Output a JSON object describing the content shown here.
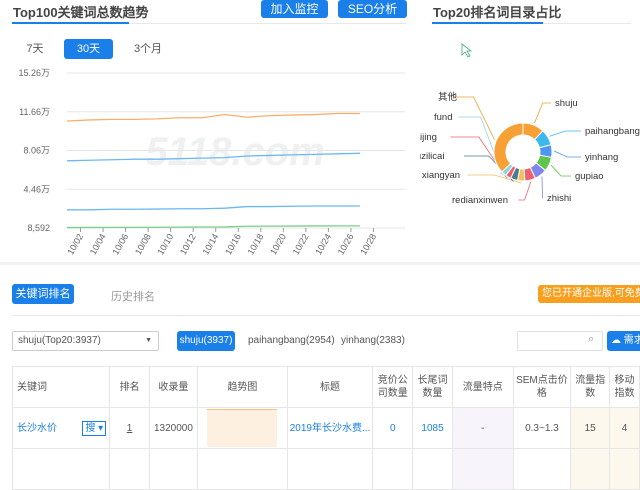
{
  "trend": {
    "title": "Top100关键词总数趋势",
    "btn_monitor": "加入监控",
    "btn_seo": "SEO分析",
    "ranges": [
      "7天",
      "30天",
      "3个月"
    ],
    "active_range": "30天"
  },
  "chart_data": {
    "type": "line",
    "title": "Top100关键词总数趋势",
    "y_ticks": [
      "8,592",
      "4.46万",
      "8.06万",
      "11.66万",
      "15.26万"
    ],
    "ylim": [
      8592,
      152592
    ],
    "x": [
      "10/02",
      "10/04",
      "10/06",
      "10/08",
      "10/10",
      "10/12",
      "10/14",
      "10/16",
      "10/18",
      "10/20",
      "10/22",
      "10/24",
      "10/26",
      "10/28"
    ],
    "series": [
      {
        "name": "series-orange",
        "color": "#f7b06a",
        "values": [
          108000,
          109000,
          109500,
          109500,
          110000,
          111000,
          111000,
          114000,
          111500,
          113000,
          113500,
          114000,
          115000,
          115000
        ]
      },
      {
        "name": "series-blue-1",
        "color": "#6cb8f0",
        "values": [
          71000,
          71500,
          72000,
          72500,
          72500,
          73000,
          73500,
          74000,
          75500,
          76000,
          76500,
          77000,
          77500,
          78000
        ]
      },
      {
        "name": "series-blue-2",
        "color": "#6cb8f0",
        "values": [
          25500,
          25500,
          26000,
          26000,
          26200,
          26500,
          26500,
          27000,
          28500,
          28500,
          28800,
          29000,
          29000,
          29000
        ]
      },
      {
        "name": "series-green",
        "color": "#7ccf8a",
        "values": [
          9000,
          9100,
          9200,
          9200,
          9300,
          9400,
          9500,
          9600,
          10200,
          10300,
          10400,
          10500,
          10600,
          10600
        ]
      }
    ],
    "watermark": "5118.com"
  },
  "pie": {
    "title": "Top20排名词目录占比",
    "chart_data": {
      "type": "pie",
      "slices": [
        {
          "label": "shuju",
          "value": 12,
          "color": "#f7a035"
        },
        {
          "label": "paihangbang",
          "value": 9,
          "color": "#3bb8ec"
        },
        {
          "label": "yinhang",
          "value": 7,
          "color": "#4e97f0"
        },
        {
          "label": "gupiao",
          "value": 8,
          "color": "#5fc54a"
        },
        {
          "label": "zhishi",
          "value": 7,
          "color": "#7f86ef"
        },
        {
          "label": "redianxinwen",
          "value": 6,
          "color": "#f0606f"
        },
        {
          "label": "xiangyan",
          "value": 4,
          "color": "#f0c060"
        },
        {
          "label": "touzilicai",
          "value": 4,
          "color": "#4e7a90"
        },
        {
          "label": "caijing",
          "value": 3,
          "color": "#ef5f6a"
        },
        {
          "label": "fund",
          "value": 3,
          "color": "#8fd5e0"
        },
        {
          "label": "其他",
          "value": 37,
          "color": "#f7a035"
        }
      ]
    }
  },
  "tabs": {
    "active": "关键词排名",
    "other": "历史排名",
    "notice": "您已开通企业版,可免费使"
  },
  "filter": {
    "select": "shuju(Top20:3937)",
    "chips": [
      "shuju(3937)",
      "paihangbang(2954)",
      "yinhang(2383)"
    ],
    "search_placeholder": "",
    "demand_btn": "需求"
  },
  "table": {
    "headers": [
      "关键词",
      "排名",
      "收录量",
      "趋势图",
      "标题",
      "竞价公司数量",
      "长尾词数量",
      "流量特点",
      "SEM点击价格",
      "流量指数",
      "移动指数"
    ],
    "rows": [
      {
        "keyword": "长沙水价",
        "engine": "搜",
        "rank": "1",
        "indexed": "1320000",
        "title": "2019年长沙水费...",
        "bid": "0",
        "longtail": "1085",
        "traffic": "-",
        "sem": "0.3~1.3",
        "flow": "15",
        "mobile": "4"
      }
    ]
  }
}
